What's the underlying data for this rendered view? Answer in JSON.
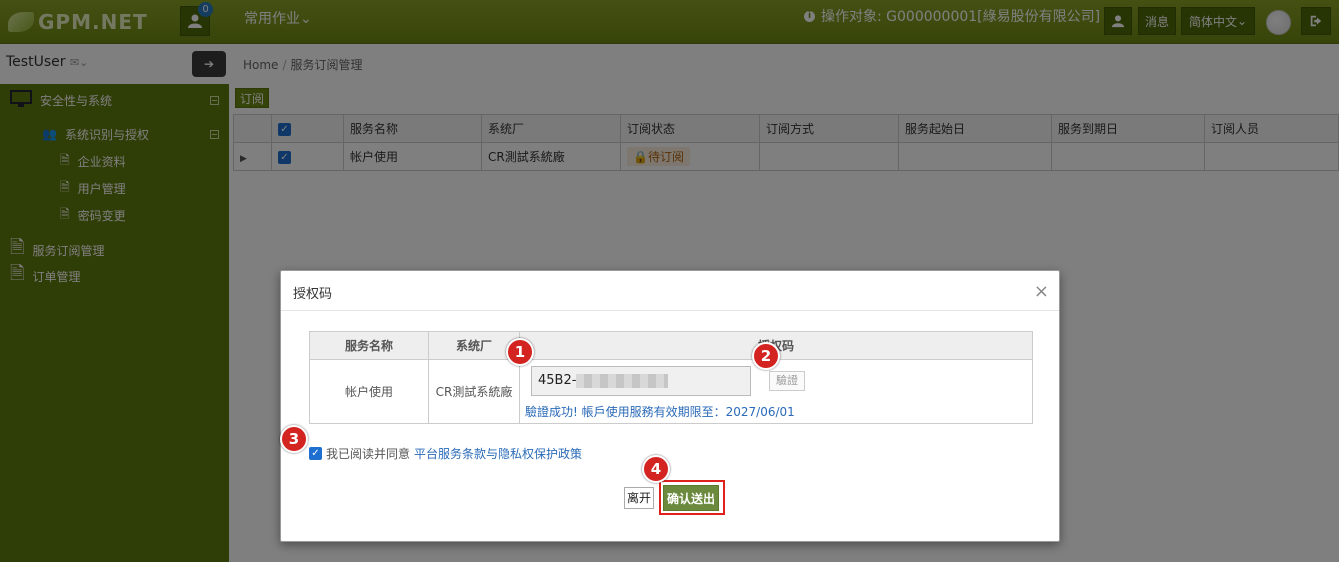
{
  "topbar": {
    "logo": "GPM.NET",
    "notification_count": "0",
    "menu_label": "常用作业",
    "target_label": "操作对象: G000000001[綠易股份有限公司]",
    "messages_label": "消息",
    "language_label": "简体中文"
  },
  "sidebar": {
    "username": "TestUser",
    "items": [
      {
        "label": "安全性与系统"
      },
      {
        "label": "系统识别与授权"
      },
      {
        "label": "企业资料"
      },
      {
        "label": "用户管理"
      },
      {
        "label": "密码变更"
      },
      {
        "label": "服务订阅管理"
      },
      {
        "label": "订单管理"
      }
    ]
  },
  "main": {
    "breadcrumb_home": "Home",
    "breadcrumb_sep": "/",
    "breadcrumb_current": "服务订阅管理",
    "subscribe_label": "订阅",
    "table": {
      "headers": [
        "服务名称",
        "系统厂",
        "订阅状态",
        "订阅方式",
        "服务起始日",
        "服务到期日",
        "订阅人员"
      ],
      "rows": [
        {
          "service": "帐户使用",
          "vendor": "CR測試系統廠",
          "status": "待订阅",
          "method": "",
          "start": "",
          "end": "",
          "person": ""
        }
      ]
    }
  },
  "modal": {
    "title": "授权码",
    "close": "×",
    "headers": [
      "服务名称",
      "系统厂",
      "授权码"
    ],
    "row": {
      "service": "帐户使用",
      "vendor": "CR測試系統廠",
      "code_value": "45B2-",
      "verify_label": "驗證",
      "verify_msg": "驗證成功! 帳戶使用服務有效期限至：2027/06/01"
    },
    "agree_text": "我已阅读并同意",
    "agree_link": "平台服务条款与隐私权保护政策",
    "leave_label": "离开",
    "confirm_label": "确认送出"
  },
  "markers": [
    "1",
    "2",
    "3",
    "4"
  ]
}
